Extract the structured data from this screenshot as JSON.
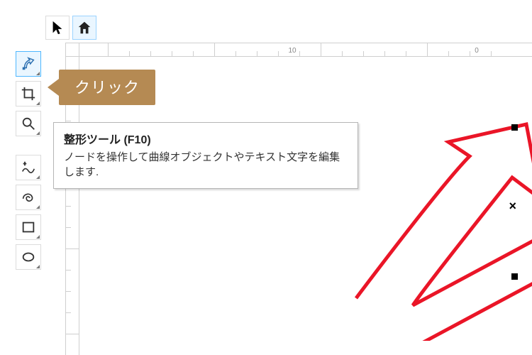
{
  "topbar": {
    "pick_btn": "pick",
    "home_btn": "home"
  },
  "toolbox": {
    "shape_tool": "shape",
    "crop_tool": "crop",
    "zoom_tool": "zoom",
    "freehand_tool": "freehand",
    "spiral_tool": "spiral",
    "rectangle_tool": "rectangle",
    "ellipse_tool": "ellipse"
  },
  "ruler": {
    "label_10": "10",
    "label_0": "0"
  },
  "callout": {
    "label": "クリック"
  },
  "tooltip": {
    "title": "整形ツール (F10)",
    "body": "ノードを操作して曲線オブジェクトやテキスト文字を編集します."
  }
}
